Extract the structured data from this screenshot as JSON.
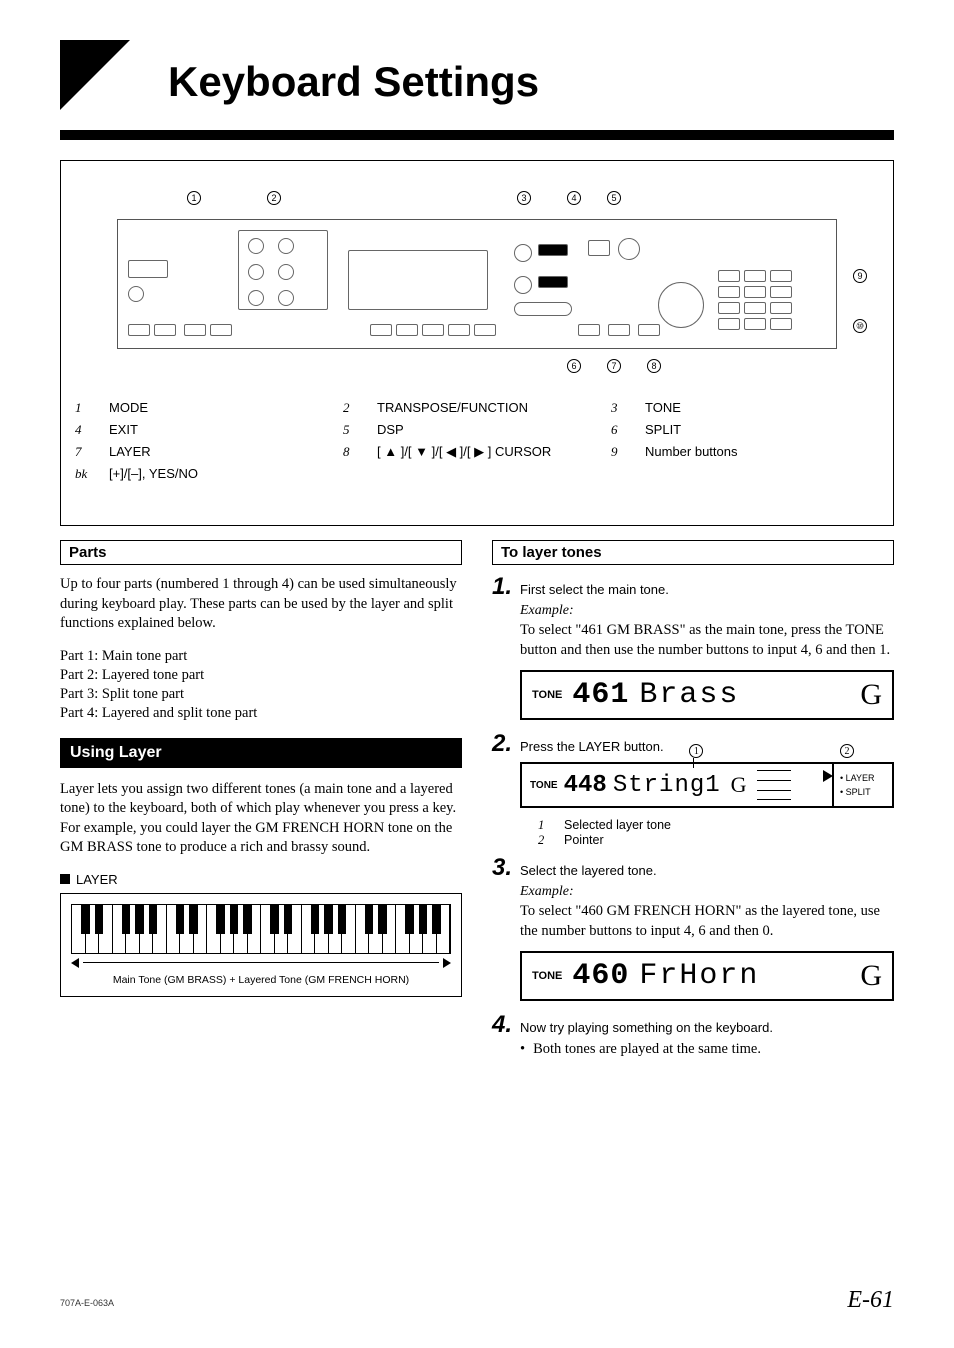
{
  "title": "Keyboard Settings",
  "panel_legend": [
    {
      "n": "1",
      "label": "MODE"
    },
    {
      "n": "2",
      "label": "TRANSPOSE/FUNCTION"
    },
    {
      "n": "3",
      "label": "TONE"
    },
    {
      "n": "4",
      "label": "EXIT"
    },
    {
      "n": "5",
      "label": "DSP"
    },
    {
      "n": "6",
      "label": "SPLIT"
    },
    {
      "n": "7",
      "label": "LAYER"
    },
    {
      "n": "8",
      "label": "[ ▲ ]/[ ▼ ]/[ ◀ ]/[ ▶ ] CURSOR"
    },
    {
      "n": "9",
      "label": "Number buttons"
    },
    {
      "n": "bk",
      "label": "[+]/[–], YES/NO"
    }
  ],
  "parts": {
    "heading": "Parts",
    "intro": "Up to four parts (numbered 1 through 4) can be used simultaneously during keyboard play. These parts can be used by the layer and split functions explained below.",
    "list": [
      "Part 1:  Main tone part",
      "Part 2:  Layered tone part",
      "Part 3:  Split tone part",
      "Part 4:  Layered and split tone part"
    ]
  },
  "using_layer": {
    "heading": "Using Layer",
    "para": "Layer lets you assign two different tones (a main tone and a layered tone) to the keyboard, both of which play whenever you press a key. For example, you could layer the GM FRENCH HORN tone on the GM BRASS tone to produce a rich and brassy sound.",
    "fig_label": "LAYER",
    "fig_caption": "Main Tone (GM BRASS) + Layered Tone (GM FRENCH HORN)"
  },
  "to_layer": {
    "heading": "To layer tones",
    "step1": {
      "num": "1.",
      "text": "First select the main tone.",
      "example_label": "Example:",
      "example_body": "To select \"461 GM BRASS\" as the main tone, press the TONE button and then use the number buttons to input 4, 6 and then 1."
    },
    "disp1": {
      "label": "TONE",
      "number": "461",
      "text": "Brass",
      "g": "G"
    },
    "step2": {
      "num": "2.",
      "text": "Press the LAYER button."
    },
    "disp2": {
      "label": "TONE",
      "number": "448",
      "text": "String1",
      "g": "G",
      "side1": "LAYER",
      "side2": "SPLIT",
      "call1": "1",
      "call2": "2"
    },
    "disp2_legend": [
      {
        "n": "1",
        "t": "Selected layer tone"
      },
      {
        "n": "2",
        "t": "Pointer"
      }
    ],
    "step3": {
      "num": "3.",
      "text": "Select the layered tone.",
      "example_label": "Example:",
      "example_body": "To select \"460 GM FRENCH HORN\" as the layered tone, use the number buttons to input 4, 6 and then 0."
    },
    "disp3": {
      "label": "TONE",
      "number": "460",
      "text": "FrHorn",
      "g": "G"
    },
    "step4": {
      "num": "4.",
      "text": "Now try playing something on the keyboard."
    },
    "step4_bullet": "Both tones are played at the same time."
  },
  "footer": {
    "left": "707A-E-063A",
    "right": "E-61"
  }
}
